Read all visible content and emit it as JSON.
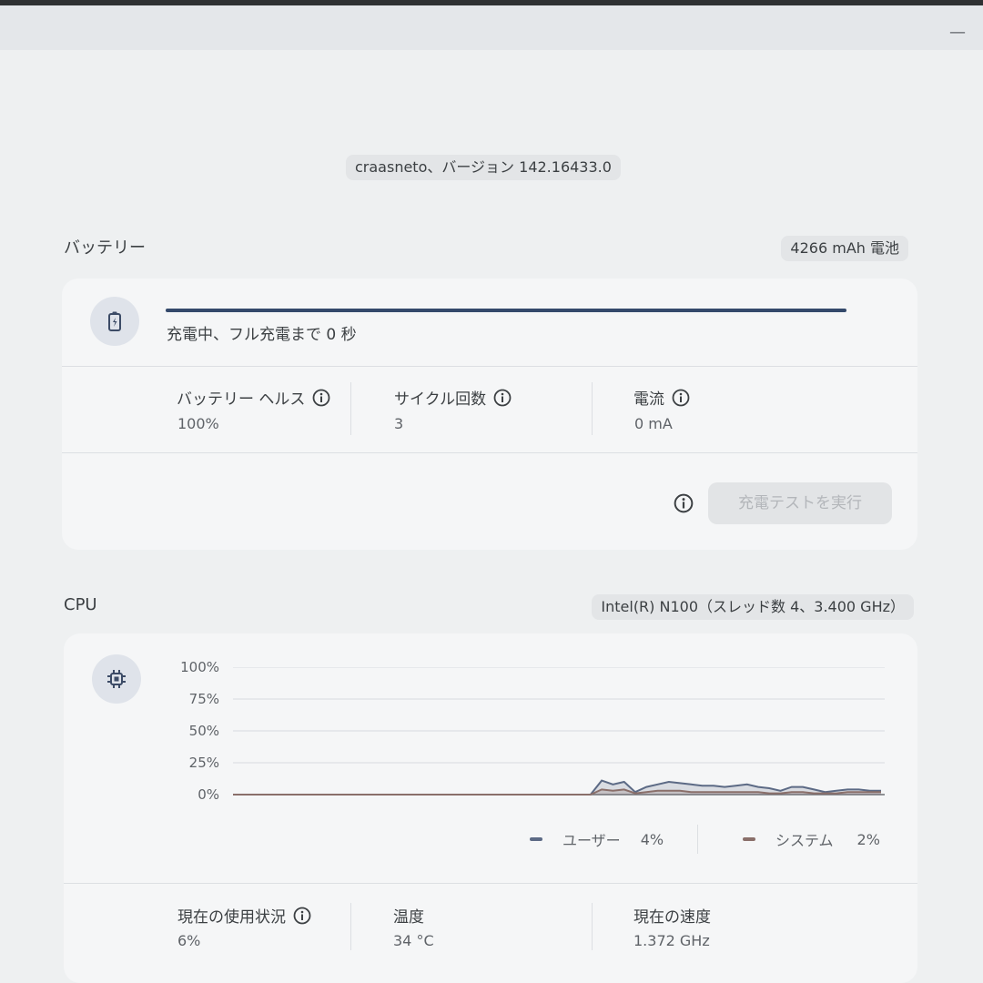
{
  "header": {
    "version": "craasneto、バージョン 142.16433.0"
  },
  "battery": {
    "title": "バッテリー",
    "capacity_chip": "4266 mAh 電池",
    "status": "充電中、フル充電まで 0 秒",
    "progress_percent": 100,
    "stats": [
      {
        "label": "バッテリー ヘルス",
        "value": "100%"
      },
      {
        "label": "サイクル回数",
        "value": "3"
      },
      {
        "label": "電流",
        "value": "0 mA"
      }
    ],
    "run_test_button": "充電テストを実行"
  },
  "cpu": {
    "title": "CPU",
    "model_chip": "Intel(R) N100（スレッド数 4、3.400 GHz）",
    "legend": [
      {
        "label": "ユーザー",
        "value": "4%",
        "color": "#5c6a85"
      },
      {
        "label": "システム",
        "value": "2%",
        "color": "#8a6f6a"
      }
    ],
    "stats": [
      {
        "label": "現在の使用状況",
        "value": "6%"
      },
      {
        "label": "温度",
        "value": "34 °C"
      },
      {
        "label": "現在の速度",
        "value": "1.372 GHz"
      }
    ]
  },
  "chart_data": {
    "type": "area",
    "y_ticks": [
      "100%",
      "75%",
      "50%",
      "25%",
      "0%"
    ],
    "ylim": [
      0,
      100
    ],
    "x": [
      0,
      1,
      2,
      3,
      4,
      5,
      6,
      7,
      8,
      9,
      10,
      11,
      12,
      13,
      14,
      15,
      16,
      17,
      18,
      19,
      20,
      21,
      22,
      23,
      24,
      25,
      26,
      27,
      28,
      29,
      30,
      31,
      32,
      33,
      34,
      35,
      36,
      37,
      38,
      39,
      40,
      41,
      42,
      43,
      44,
      45,
      46,
      47,
      48,
      49,
      50,
      51,
      52,
      53,
      54,
      55,
      56,
      57,
      58
    ],
    "series": [
      {
        "name": "ユーザー",
        "color": "#5c6a85",
        "values": [
          0,
          0,
          0,
          0,
          0,
          0,
          0,
          0,
          0,
          0,
          0,
          0,
          0,
          0,
          0,
          0,
          0,
          0,
          0,
          0,
          0,
          0,
          0,
          0,
          0,
          0,
          0,
          0,
          0,
          0,
          0,
          0,
          0,
          11,
          8,
          10,
          2,
          6,
          8,
          10,
          9,
          8,
          7,
          7,
          6,
          7,
          8,
          6,
          5,
          3,
          6,
          6,
          4,
          2,
          3,
          4,
          4,
          3,
          3
        ]
      },
      {
        "name": "システム",
        "color": "#8a6f6a",
        "values": [
          0,
          0,
          0,
          0,
          0,
          0,
          0,
          0,
          0,
          0,
          0,
          0,
          0,
          0,
          0,
          0,
          0,
          0,
          0,
          0,
          0,
          0,
          0,
          0,
          0,
          0,
          0,
          0,
          0,
          0,
          0,
          0,
          0,
          4,
          3,
          4,
          1,
          2,
          3,
          3,
          3,
          2,
          2,
          2,
          2,
          2,
          2,
          2,
          1,
          1,
          2,
          2,
          1,
          1,
          1,
          2,
          2,
          2,
          2
        ]
      }
    ]
  }
}
